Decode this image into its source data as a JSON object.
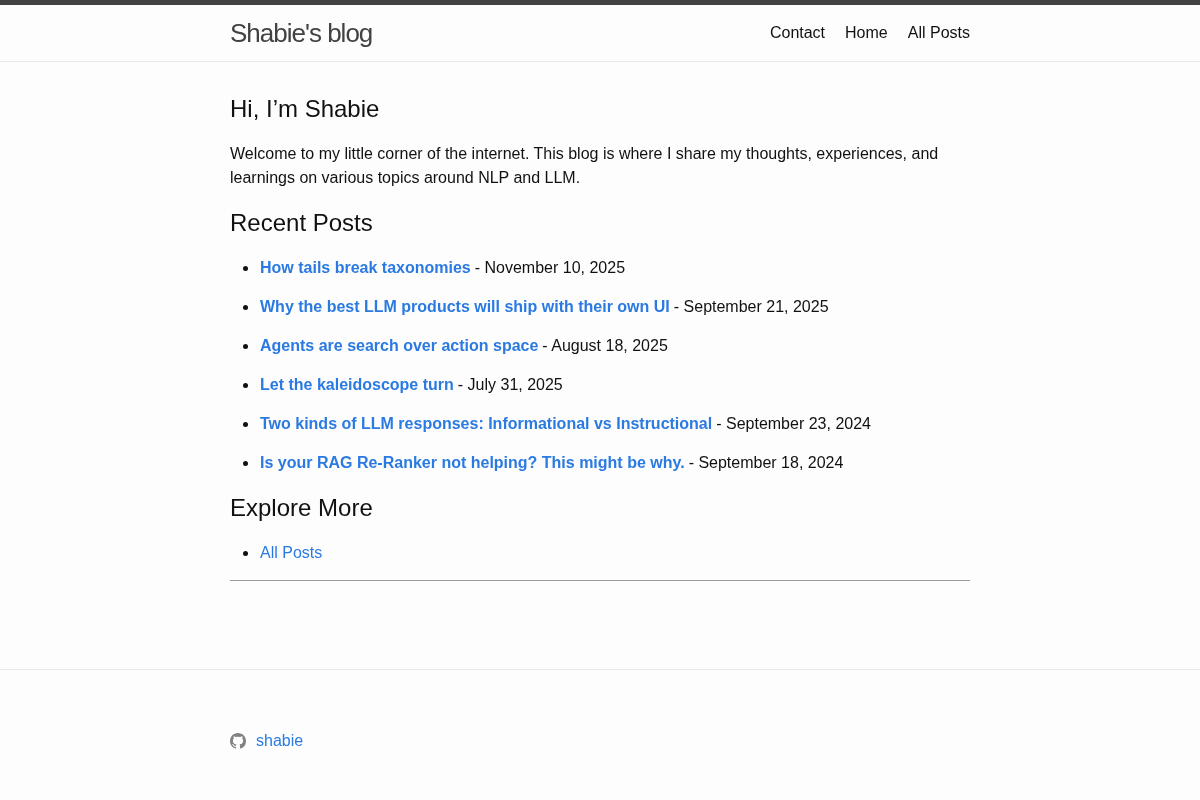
{
  "header": {
    "site_title": "Shabie's blog",
    "nav": [
      {
        "label": "Contact"
      },
      {
        "label": "Home"
      },
      {
        "label": "All Posts"
      }
    ]
  },
  "intro": {
    "heading": "Hi, I’m Shabie",
    "text": "Welcome to my little corner of the internet. This blog is where I share my thoughts, experiences, and learnings on various topics around NLP and LLM."
  },
  "recent_posts": {
    "heading": "Recent Posts",
    "posts": [
      {
        "title": "How tails break taxonomies",
        "date": "- November 10, 2025"
      },
      {
        "title": "Why the best LLM products will ship with their own UI",
        "date": "- September 21, 2025"
      },
      {
        "title": "Agents are search over action space",
        "date": "- August 18, 2025"
      },
      {
        "title": "Let the kaleidoscope turn",
        "date": "- July 31, 2025"
      },
      {
        "title": "Two kinds of LLM responses: Informational vs Instructional",
        "date": "- September 23, 2024"
      },
      {
        "title": "Is your RAG Re-Ranker not helping? This might be why.",
        "date": "- September 18, 2024"
      }
    ]
  },
  "explore_more": {
    "heading": "Explore More",
    "links": [
      {
        "label": "All Posts"
      }
    ]
  },
  "footer": {
    "github_username": "shabie"
  }
}
